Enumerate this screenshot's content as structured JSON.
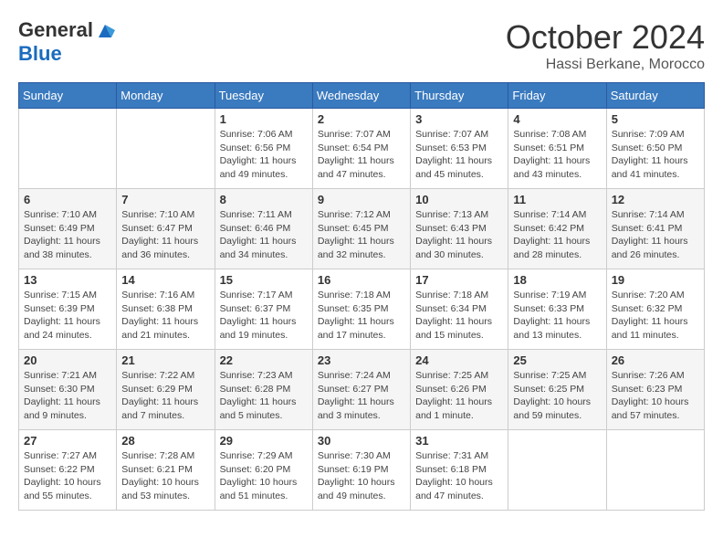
{
  "header": {
    "logo_general": "General",
    "logo_blue": "Blue",
    "month": "October 2024",
    "location": "Hassi Berkane, Morocco"
  },
  "weekdays": [
    "Sunday",
    "Monday",
    "Tuesday",
    "Wednesday",
    "Thursday",
    "Friday",
    "Saturday"
  ],
  "weeks": [
    [
      {
        "day": "",
        "info": ""
      },
      {
        "day": "",
        "info": ""
      },
      {
        "day": "1",
        "info": "Sunrise: 7:06 AM\nSunset: 6:56 PM\nDaylight: 11 hours and 49 minutes."
      },
      {
        "day": "2",
        "info": "Sunrise: 7:07 AM\nSunset: 6:54 PM\nDaylight: 11 hours and 47 minutes."
      },
      {
        "day": "3",
        "info": "Sunrise: 7:07 AM\nSunset: 6:53 PM\nDaylight: 11 hours and 45 minutes."
      },
      {
        "day": "4",
        "info": "Sunrise: 7:08 AM\nSunset: 6:51 PM\nDaylight: 11 hours and 43 minutes."
      },
      {
        "day": "5",
        "info": "Sunrise: 7:09 AM\nSunset: 6:50 PM\nDaylight: 11 hours and 41 minutes."
      }
    ],
    [
      {
        "day": "6",
        "info": "Sunrise: 7:10 AM\nSunset: 6:49 PM\nDaylight: 11 hours and 38 minutes."
      },
      {
        "day": "7",
        "info": "Sunrise: 7:10 AM\nSunset: 6:47 PM\nDaylight: 11 hours and 36 minutes."
      },
      {
        "day": "8",
        "info": "Sunrise: 7:11 AM\nSunset: 6:46 PM\nDaylight: 11 hours and 34 minutes."
      },
      {
        "day": "9",
        "info": "Sunrise: 7:12 AM\nSunset: 6:45 PM\nDaylight: 11 hours and 32 minutes."
      },
      {
        "day": "10",
        "info": "Sunrise: 7:13 AM\nSunset: 6:43 PM\nDaylight: 11 hours and 30 minutes."
      },
      {
        "day": "11",
        "info": "Sunrise: 7:14 AM\nSunset: 6:42 PM\nDaylight: 11 hours and 28 minutes."
      },
      {
        "day": "12",
        "info": "Sunrise: 7:14 AM\nSunset: 6:41 PM\nDaylight: 11 hours and 26 minutes."
      }
    ],
    [
      {
        "day": "13",
        "info": "Sunrise: 7:15 AM\nSunset: 6:39 PM\nDaylight: 11 hours and 24 minutes."
      },
      {
        "day": "14",
        "info": "Sunrise: 7:16 AM\nSunset: 6:38 PM\nDaylight: 11 hours and 21 minutes."
      },
      {
        "day": "15",
        "info": "Sunrise: 7:17 AM\nSunset: 6:37 PM\nDaylight: 11 hours and 19 minutes."
      },
      {
        "day": "16",
        "info": "Sunrise: 7:18 AM\nSunset: 6:35 PM\nDaylight: 11 hours and 17 minutes."
      },
      {
        "day": "17",
        "info": "Sunrise: 7:18 AM\nSunset: 6:34 PM\nDaylight: 11 hours and 15 minutes."
      },
      {
        "day": "18",
        "info": "Sunrise: 7:19 AM\nSunset: 6:33 PM\nDaylight: 11 hours and 13 minutes."
      },
      {
        "day": "19",
        "info": "Sunrise: 7:20 AM\nSunset: 6:32 PM\nDaylight: 11 hours and 11 minutes."
      }
    ],
    [
      {
        "day": "20",
        "info": "Sunrise: 7:21 AM\nSunset: 6:30 PM\nDaylight: 11 hours and 9 minutes."
      },
      {
        "day": "21",
        "info": "Sunrise: 7:22 AM\nSunset: 6:29 PM\nDaylight: 11 hours and 7 minutes."
      },
      {
        "day": "22",
        "info": "Sunrise: 7:23 AM\nSunset: 6:28 PM\nDaylight: 11 hours and 5 minutes."
      },
      {
        "day": "23",
        "info": "Sunrise: 7:24 AM\nSunset: 6:27 PM\nDaylight: 11 hours and 3 minutes."
      },
      {
        "day": "24",
        "info": "Sunrise: 7:25 AM\nSunset: 6:26 PM\nDaylight: 11 hours and 1 minute."
      },
      {
        "day": "25",
        "info": "Sunrise: 7:25 AM\nSunset: 6:25 PM\nDaylight: 10 hours and 59 minutes."
      },
      {
        "day": "26",
        "info": "Sunrise: 7:26 AM\nSunset: 6:23 PM\nDaylight: 10 hours and 57 minutes."
      }
    ],
    [
      {
        "day": "27",
        "info": "Sunrise: 7:27 AM\nSunset: 6:22 PM\nDaylight: 10 hours and 55 minutes."
      },
      {
        "day": "28",
        "info": "Sunrise: 7:28 AM\nSunset: 6:21 PM\nDaylight: 10 hours and 53 minutes."
      },
      {
        "day": "29",
        "info": "Sunrise: 7:29 AM\nSunset: 6:20 PM\nDaylight: 10 hours and 51 minutes."
      },
      {
        "day": "30",
        "info": "Sunrise: 7:30 AM\nSunset: 6:19 PM\nDaylight: 10 hours and 49 minutes."
      },
      {
        "day": "31",
        "info": "Sunrise: 7:31 AM\nSunset: 6:18 PM\nDaylight: 10 hours and 47 minutes."
      },
      {
        "day": "",
        "info": ""
      },
      {
        "day": "",
        "info": ""
      }
    ]
  ]
}
